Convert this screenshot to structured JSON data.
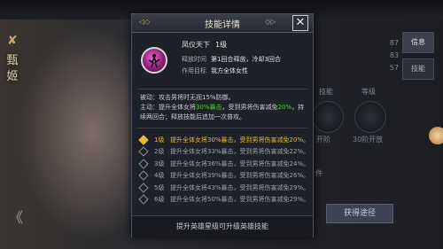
{
  "background": {
    "hero_name": "甄姬",
    "back_icon": "double-chevron-left",
    "stats": [
      {
        "label": "智力",
        "value": "87"
      },
      {
        "label": "统帅",
        "value": "83"
      },
      {
        "label": "魅力",
        "value": "57"
      }
    ],
    "skill_labels": [
      "技能",
      "等级",
      "开阶",
      "30阶开放"
    ],
    "condition_label": "件",
    "obtain_button": "获得途径",
    "side_tabs": [
      "信息",
      "技能"
    ]
  },
  "dialog": {
    "title": "技能详情",
    "close_icon": "close-x",
    "skill": {
      "name": "凤仪天下",
      "level": "1级",
      "release_label": "释放时间",
      "release_value": "第1回合释放，冷却3回合",
      "target_label": "作用目标",
      "target_value": "我方全体女性"
    },
    "description": {
      "passive": "被动：攻击男将时无视15%防御。",
      "active_a": "主动：提升全体女将",
      "active_b": "30%暴击",
      "active_c": "，受到男将伤害减免",
      "active_d": "20%",
      "active_e": "，持续两回合；释放技能后追加一次普攻。"
    },
    "levels": [
      {
        "label": "1级",
        "text": "提升全体女将30%暴击，受到男将伤害减免20%。",
        "active": true
      },
      {
        "label": "2级",
        "text": "提升全体女将33%暴击，受到男将伤害减免22%。",
        "active": false
      },
      {
        "label": "3级",
        "text": "提升全体女将36%暴击，受到男将伤害减免24%。",
        "active": false
      },
      {
        "label": "4级",
        "text": "提升全体女将39%暴击，受到男将伤害减免26%。",
        "active": false
      },
      {
        "label": "5级",
        "text": "提升全体女将43%暴击，受到男将伤害减免29%。",
        "active": false
      },
      {
        "label": "6级",
        "text": "提升全体女将50%暴击，受到男将伤害减免29%。",
        "active": false
      }
    ],
    "footer": "提升英雄星级可升级英雄技能"
  }
}
